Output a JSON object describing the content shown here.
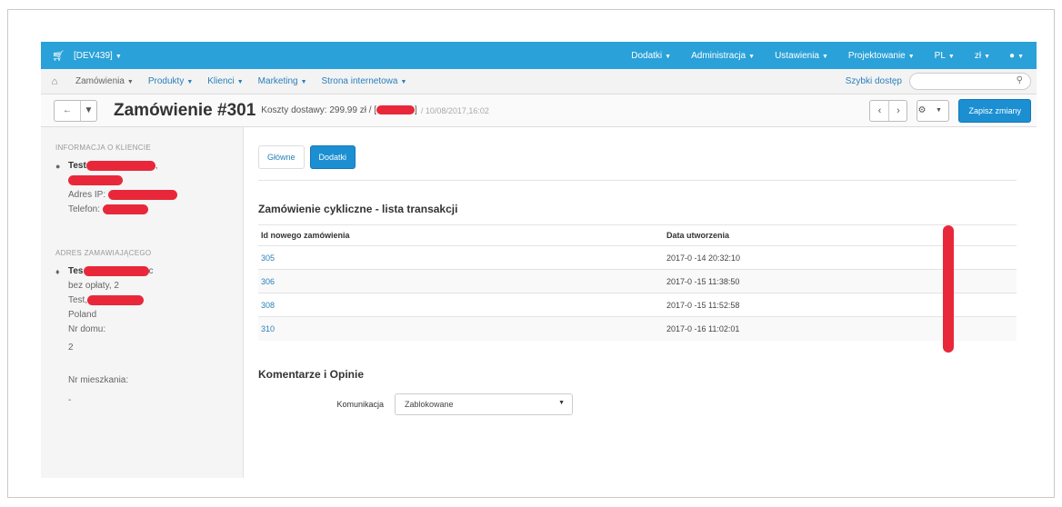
{
  "topbar": {
    "store_label": "[DEV439]",
    "menus": [
      "Dodatki",
      "Administracja",
      "Ustawienia",
      "Projektowanie",
      "PL",
      "zł"
    ]
  },
  "subnav": {
    "menus": [
      "Zamówienia",
      "Produkty",
      "Klienci",
      "Marketing",
      "Strona internetowa"
    ],
    "quick_access": "Szybki dostęp",
    "search_placeholder": ""
  },
  "titlebar": {
    "title": "Zamówienie #301",
    "meta_prefix": "Koszty dostawy: 299.99 zł / [",
    "meta_suffix": "]",
    "date": "/ 10/08/2017,16:02",
    "save_label": "Zapisz zmiany"
  },
  "sidebar": {
    "customer_heading": "INFORMACJA O KLIENCIE",
    "customer_name": "Test",
    "customer_name_suffix": ",",
    "ip_label": "Adres IP:",
    "phone_label": "Telefon:",
    "address_heading": "ADRES ZAMAWIAJĄCEGO",
    "address_name": "Tes",
    "address_name_suffix": "c",
    "address_line1": "bez opłaty, 2",
    "address_line2": "Test,",
    "country": "Poland",
    "house_label": "Nr domu:",
    "house_value": "2",
    "flat_label": "Nr mieszkania:",
    "flat_value": "-"
  },
  "tabs": [
    "Główne",
    "Dodatki"
  ],
  "transactions": {
    "title": "Zamówienie cykliczne - lista transakcji",
    "headers": [
      "Id nowego zamówienia",
      "Data utworzenia"
    ],
    "rows": [
      {
        "id": "305",
        "date": "2017-0 -14 20:32:10"
      },
      {
        "id": "306",
        "date": "2017-0 -15 11:38:50"
      },
      {
        "id": "308",
        "date": "2017-0 -15 11:52:58"
      },
      {
        "id": "310",
        "date": "2017-0 -16 11:02:01"
      }
    ]
  },
  "comments": {
    "title": "Komentarze i Opinie",
    "label": "Komunikacja",
    "value": "Zablokowane"
  }
}
